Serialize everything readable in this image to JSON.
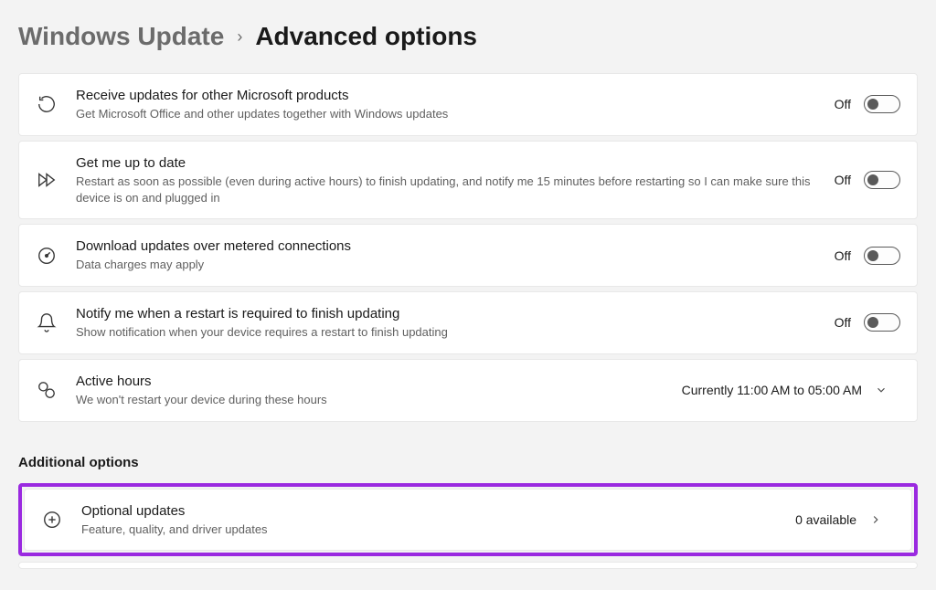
{
  "breadcrumb": {
    "parent": "Windows Update",
    "current": "Advanced options"
  },
  "rows": [
    {
      "title": "Receive updates for other Microsoft products",
      "desc": "Get Microsoft Office and other updates together with Windows updates",
      "state": "Off"
    },
    {
      "title": "Get me up to date",
      "desc": "Restart as soon as possible (even during active hours) to finish updating, and notify me 15 minutes before restarting so I can make sure this device is on and plugged in",
      "state": "Off"
    },
    {
      "title": "Download updates over metered connections",
      "desc": "Data charges may apply",
      "state": "Off"
    },
    {
      "title": "Notify me when a restart is required to finish updating",
      "desc": "Show notification when your device requires a restart to finish updating",
      "state": "Off"
    }
  ],
  "activeHours": {
    "title": "Active hours",
    "desc": "We won't restart your device during these hours",
    "value": "Currently 11:00 AM to 05:00 AM"
  },
  "sectionHead": "Additional options",
  "optional": {
    "title": "Optional updates",
    "desc": "Feature, quality, and driver updates",
    "value": "0 available"
  }
}
